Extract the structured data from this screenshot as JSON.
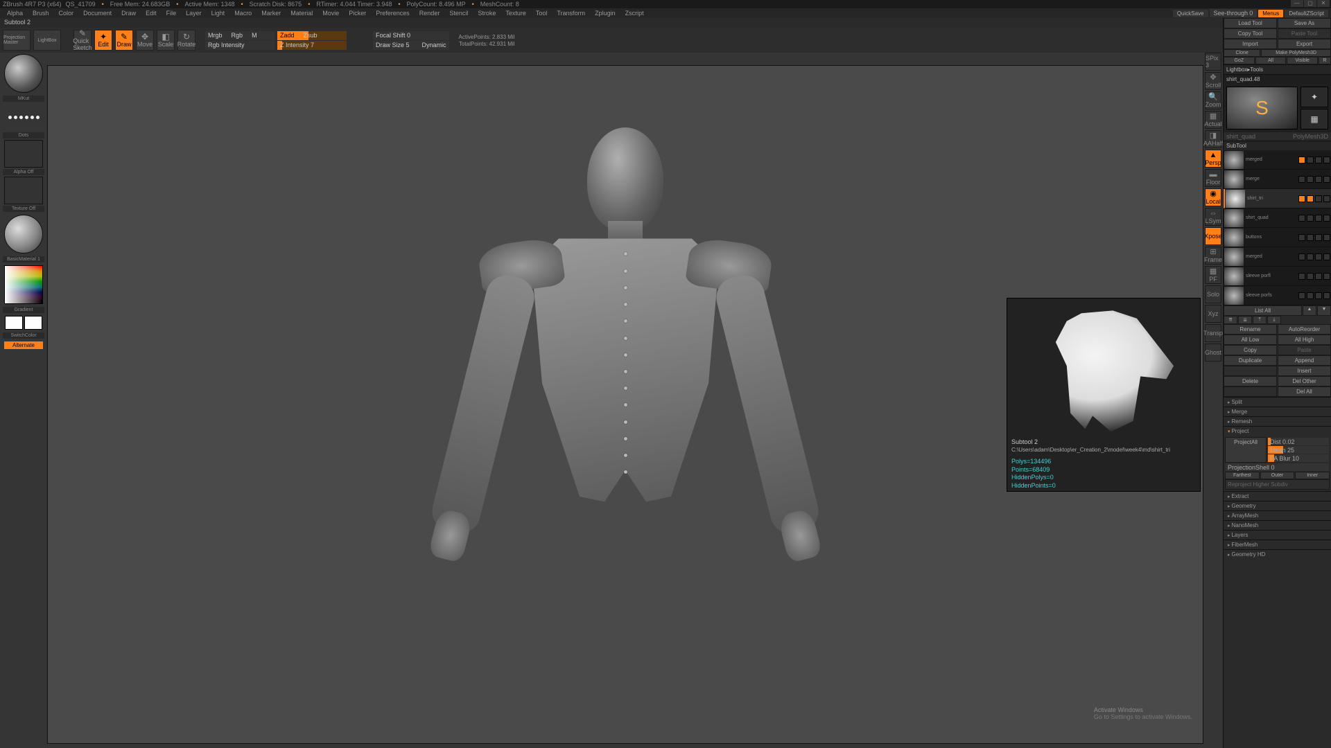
{
  "title": {
    "app": "ZBrush 4R7 P3 (x64)",
    "doc": "QS_41709",
    "freemem": "Free Mem: 24.683GB",
    "activemem": "Active Mem: 1348",
    "scratch": "Scratch Disk: 8675",
    "rtimer": "RTimer: 4.044 Timer: 3.948",
    "polycount": "PolyCount: 8.496 MP",
    "meshcount": "MeshCount: 8"
  },
  "menu": [
    "Alpha",
    "Brush",
    "Color",
    "Document",
    "Draw",
    "Edit",
    "File",
    "Layer",
    "Light",
    "Macro",
    "Marker",
    "Material",
    "Movie",
    "Picker",
    "Preferences",
    "Render",
    "Stencil",
    "Stroke",
    "Texture",
    "Tool",
    "Transform",
    "Zplugin",
    "Zscript"
  ],
  "menur": {
    "quicksave": "QuickSave",
    "see": "See-through",
    "seeval": "0",
    "menus": "Menus",
    "dz": "DefaultZScript"
  },
  "hint": "Subtool 2",
  "toolbar": {
    "pm": "Projection Master",
    "lb": "LightBox",
    "qs": "Quick Sketch",
    "edit": "Edit",
    "draw": "Draw",
    "move": "Move",
    "scale": "Scale",
    "rotate": "Rotate",
    "mrgb": "Mrgb",
    "rgb": "Rgb",
    "m": "M",
    "zadd": "Zadd",
    "zsub": "Zsub",
    "rgbint": "Rgb Intensity",
    "zint": "Z Intensity 7",
    "focal": "Focal Shift 0",
    "dsize": "Draw Size 5",
    "dyn": "Dynamic",
    "ap": "ActivePoints: 2.833 Mil",
    "tp": "TotalPoints: 42.931 Mil"
  },
  "left": {
    "brush": "MKut",
    "stroke": "Dots",
    "alpha": "Alpha Off",
    "tex": "Texture Off",
    "mat": "BasicMaterial 1",
    "grad": "Gradient",
    "switch": "SwitchColor",
    "alt": "Alternate"
  },
  "rv": {
    "spix": "SPix 3",
    "scroll": "Scroll",
    "zoom": "Zoom",
    "actual": "Actual",
    "aahalf": "AAHalf",
    "persp": "Persp",
    "floor": "Floor",
    "local": "Local",
    "lsym": "LSym",
    "xpose": "Xpose",
    "frame": "Frame",
    "pf": "PF",
    "solo": "Solo",
    "xyz": "Xyz",
    "trans": "Transp",
    "ghost": "Ghost"
  },
  "rp": {
    "load": "Load Tool",
    "save": "Save As",
    "copy": "Copy Tool",
    "paste": "Paste Tool",
    "import": "Import",
    "export": "Export",
    "clone": "Clone",
    "mpm": "Make PolyMesh3D",
    "goz": "GoZ",
    "all": "All",
    "vis": "Visible",
    "r": "R",
    "lbt": "Lightbox▸Tools",
    "toolname": "shirt_quad.48",
    "prev": {
      "t1": "shirt_quad",
      "t2": "PolyMesh3D",
      "t3": "shirt_quad"
    },
    "subtool": "SubTool",
    "subs": [
      {
        "name": "merged",
        "sel": false
      },
      {
        "name": "merge",
        "sel": false
      },
      {
        "name": "shirt_tri",
        "sel": true
      },
      {
        "name": "shirt_quad",
        "sel": false
      },
      {
        "name": "buttons",
        "sel": false
      },
      {
        "name": "merged",
        "sel": false
      },
      {
        "name": "sleeve porfl",
        "sel": false
      },
      {
        "name": "sleeve porfs",
        "sel": false
      }
    ],
    "listall": "List All",
    "rename": "Rename",
    "autoreorder": "AutoReorder",
    "alllow": "All Low",
    "allhigh": "All High",
    "copy2": "Copy",
    "paste2": "Paste",
    "dup": "Duplicate",
    "append": "Append",
    "insert": "Insert",
    "delete": "Delete",
    "delother": "Del Other",
    "delall": "Del All",
    "split": "Split",
    "merge": "Merge",
    "remesh": "Remesh",
    "project": "Project",
    "projall": "ProjectAll",
    "dist": "Dist 0.02",
    "mean": "Mean 25",
    "pablur": "PA Blur 10",
    "projshell": "ProjectionShell 0",
    "farthest": "Farthest",
    "outer": "Outer",
    "inner": "Inner",
    "reproj": "Reproject Higher Subdiv",
    "extract": "Extract",
    "sections": [
      "Geometry",
      "ArrayMesh",
      "NanoMesh",
      "Layers",
      "FiberMesh",
      "Geometry HD"
    ]
  },
  "floatprev": {
    "title": "Subtool 2",
    "path": "C:\\Users\\adam\\Desktop\\er_Creation_2\\model\\week4\\md\\shirt_tri",
    "polys": "Polys=134496",
    "points": "Points=68409",
    "hp": "HiddenPolys=0",
    "hpt": "HiddenPoints=0"
  },
  "activate": {
    "l1": "Activate Windows",
    "l2": "Go to Settings to activate Windows."
  }
}
